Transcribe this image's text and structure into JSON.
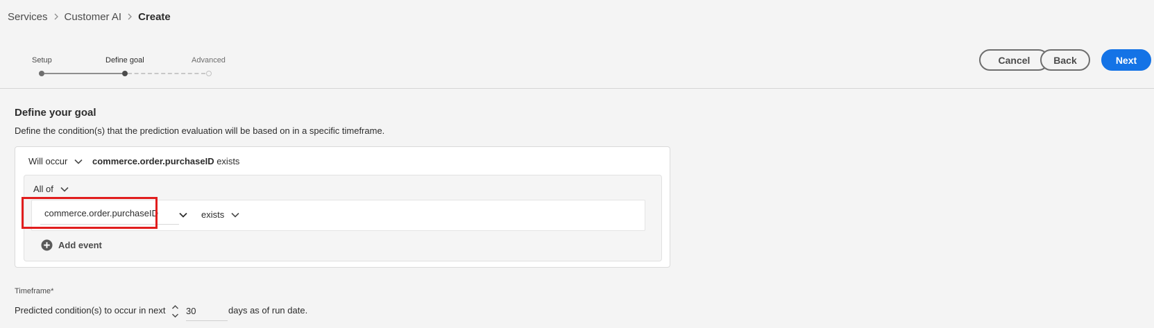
{
  "breadcrumb": {
    "items": [
      "Services",
      "Customer AI"
    ],
    "current": "Create"
  },
  "steps": [
    {
      "label": "Setup",
      "state": "done"
    },
    {
      "label": "Define goal",
      "state": "active"
    },
    {
      "label": "Advanced",
      "state": "future"
    }
  ],
  "actions": {
    "cancel": "Cancel",
    "back": "Back",
    "next": "Next"
  },
  "goal": {
    "title": "Define your goal",
    "description": "Define the condition(s) that the prediction evaluation will be based on in a specific timeframe.",
    "occurrence": "Will occur",
    "summary_field": "commerce.order.purchaseID",
    "summary_operator": "exists",
    "group_operator": "All of",
    "event_field_value": "commerce.order.purchaseID",
    "event_operator": "exists",
    "add_event_label": "Add event"
  },
  "timeframe": {
    "label": "Timeframe*",
    "prefix": "Predicted condition(s) to occur in next",
    "value": "30",
    "suffix": "days as of run date."
  },
  "colors": {
    "accent": "#1473e6",
    "highlight": "#e11d1d"
  },
  "icons": [
    "chevron-right-icon",
    "chevron-down-icon",
    "add-circle-icon",
    "stepper-icon"
  ]
}
